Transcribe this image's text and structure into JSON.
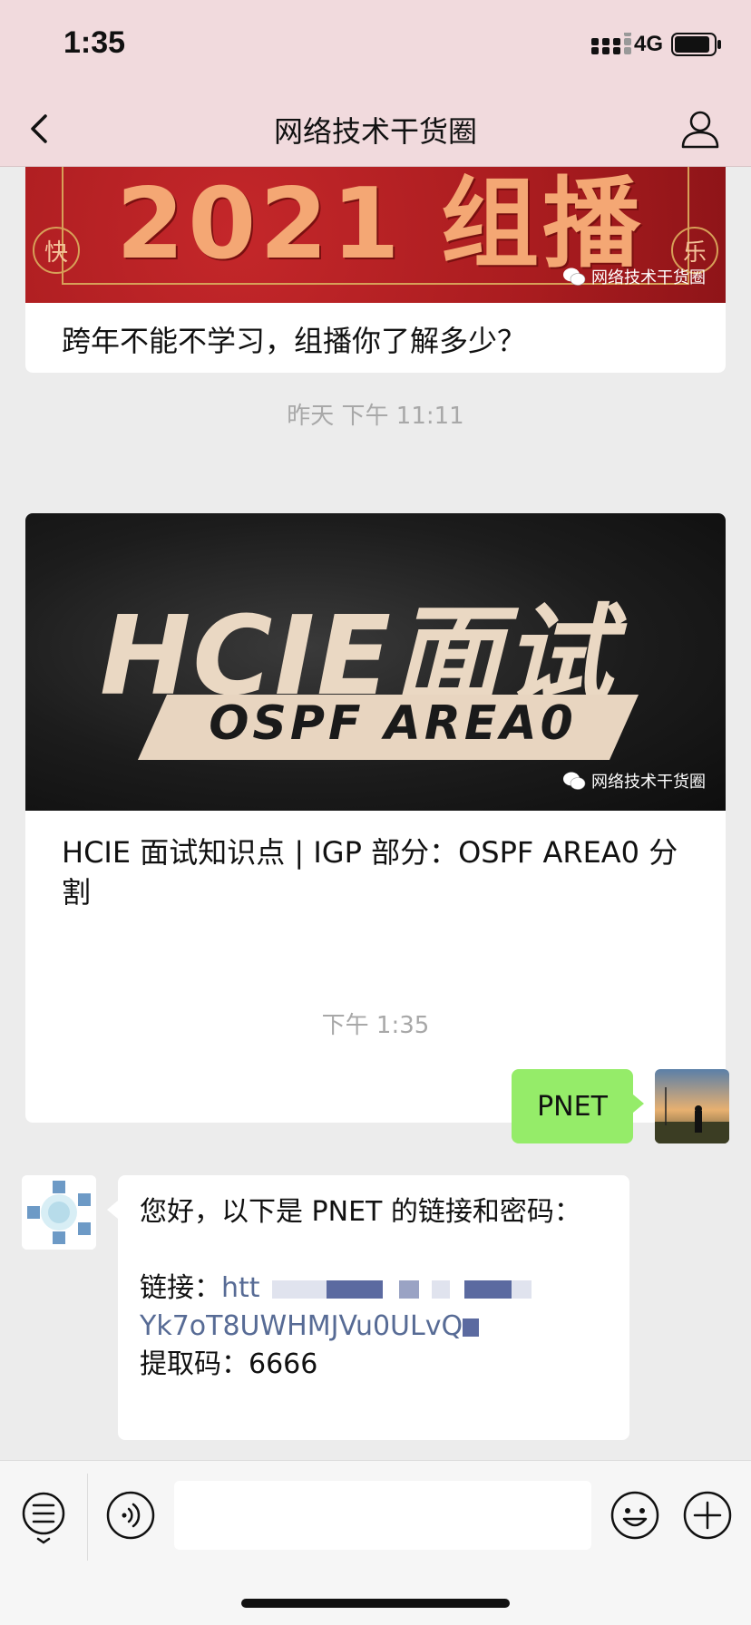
{
  "status_bar": {
    "time": "1:35",
    "network": "4G"
  },
  "nav": {
    "title": "网络技术干货圈"
  },
  "cards": [
    {
      "cover_text": "2021 组播",
      "badge_left": "快",
      "badge_right": "乐",
      "watermark": "网络技术干货圈",
      "title": "跨年不能不学习，组播你了解多少？"
    },
    {
      "cover_text": "HCIE面试",
      "cover_subtext": "OSPF AREA0",
      "watermark": "网络技术干货圈",
      "title": "HCIE 面试知识点 | IGP 部分：OSPF AREA0 分割"
    }
  ],
  "timestamps": {
    "first": "昨天 下午 11:11",
    "second": "下午 1:35"
  },
  "messages": {
    "sent": "PNET",
    "recv_line1": "您好，以下是 PNET 的链接和密码：",
    "recv_link_label": "链接：",
    "recv_link_start": "htt",
    "recv_link_rest": "Yk7oT8UWHMJVu0ULvQ",
    "recv_code_label": "提取码：",
    "recv_code": "6666"
  },
  "colors": {
    "header_bg": "#f1dadd",
    "chat_bg": "#ececec",
    "sent_bubble": "#95ec69",
    "link": "#576b95",
    "redaction": "#5b6aa0"
  },
  "icons": {
    "back": "chevron-left-icon",
    "profile": "person-icon",
    "menu": "list-menu-icon",
    "voice": "voice-icon",
    "emoji": "emoji-icon",
    "plus": "plus-icon"
  }
}
